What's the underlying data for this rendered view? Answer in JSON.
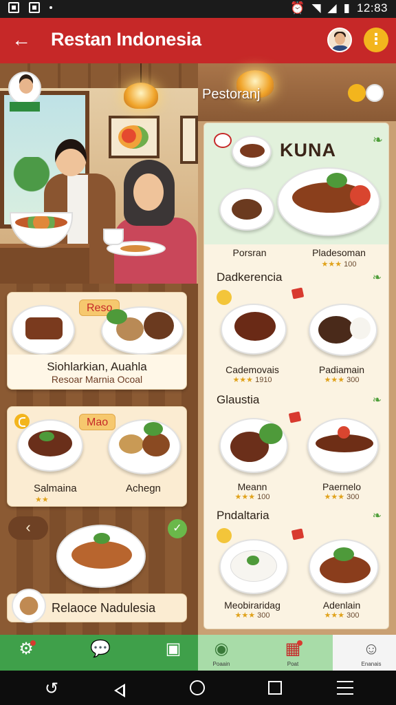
{
  "status_bar": {
    "time": "12:83"
  },
  "app_bar": {
    "title": "Restan Indonesia",
    "back_icon": "back-arrow-icon",
    "more_icon": "more-vertical-icon"
  },
  "scene": {
    "avatar_tag": "",
    "section_title_right": "Pestoranj"
  },
  "left_cards": [
    {
      "tag": "Reso",
      "title": "Siohlarkian, Auahla",
      "subtitle": "Resoar Marnia Ocoal"
    },
    {
      "tag": "Mao",
      "left_label": "Salmaina",
      "right_label": "Achegn"
    }
  ],
  "left_bottom": {
    "label": "Relaoce Nadulesia"
  },
  "menu": {
    "brand": "KUNA",
    "hero_items": [
      {
        "label": "Porsran",
        "rating": ""
      },
      {
        "label": "Pladesoman",
        "rating": "100"
      }
    ],
    "sections": [
      {
        "title": "Dadkerencia",
        "items": [
          {
            "label": "Cademovais",
            "rating": "1910"
          },
          {
            "label": "Padiamain",
            "rating": "300"
          }
        ]
      },
      {
        "title": "Glaustia",
        "items": [
          {
            "label": "Meann",
            "rating": "100"
          },
          {
            "label": "Paernelo",
            "rating": "300"
          }
        ]
      },
      {
        "title": "Pndaltaria",
        "items": [
          {
            "label": "Meobiraridag",
            "rating": "300"
          },
          {
            "label": "Adenlain",
            "rating": "300"
          }
        ]
      }
    ]
  },
  "bottom_nav": [
    {
      "icon": "settings-icon",
      "label": ""
    },
    {
      "icon": "chat-icon",
      "label": ""
    },
    {
      "icon": "book-icon",
      "label": ""
    },
    {
      "icon": "food-icon",
      "label": "Poaain"
    },
    {
      "icon": "calendar-icon",
      "label": "Poat"
    },
    {
      "icon": "robot-icon",
      "label": "Enanais"
    }
  ],
  "colors": {
    "app_bar": "#c62828",
    "nav_green": "#3fa04a",
    "accent_yellow": "#f3b51d"
  }
}
